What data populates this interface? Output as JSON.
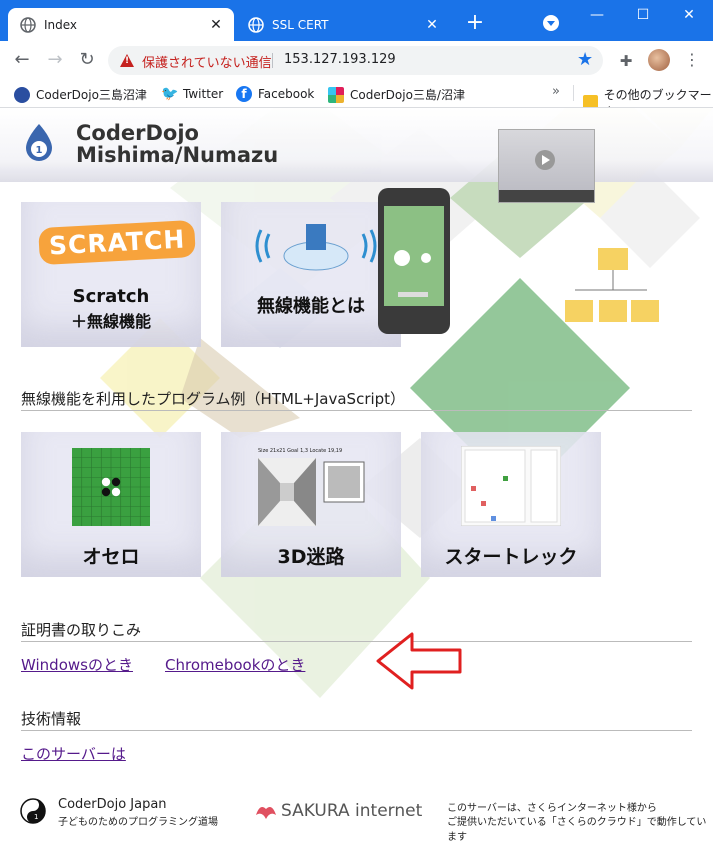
{
  "browser": {
    "tabs": [
      {
        "title": "Index",
        "active": true
      },
      {
        "title": "SSL CERT",
        "active": false
      }
    ],
    "address_bar": {
      "security_warning": "保護されていない通信",
      "url": "153.127.193.129"
    },
    "bookmarks": [
      {
        "label": "CoderDojo三島沼津",
        "icon": "coderdojo-icon"
      },
      {
        "label": "Twitter",
        "icon": "twitter-icon"
      },
      {
        "label": "Facebook",
        "icon": "facebook-icon"
      },
      {
        "label": "CoderDojo三島/沼津",
        "icon": "slack-icon"
      }
    ],
    "other_bookmarks": "その他のブックマーク"
  },
  "site": {
    "brand_line1": "CoderDojo",
    "brand_line2": "Mishima/Numazu"
  },
  "cards_top": [
    {
      "label_line1": "Scratch",
      "label_line2": "＋無線機能",
      "logo_text": "SCRATCH"
    },
    {
      "label_line1": "無線機能とは",
      "label_line2": ""
    }
  ],
  "examples_section": {
    "title": "無線機能を利用したプログラム例（HTML+JavaScript）",
    "cards": [
      {
        "label": "オセロ"
      },
      {
        "label": "3D迷路",
        "thumb_caption": "Size 21x21 Goal 1,3  Locate 19,19"
      },
      {
        "label": "スタートレック"
      }
    ]
  },
  "certificate_section": {
    "title": "証明書の取りこみ",
    "links": [
      "Windowsのとき",
      "Chromebookのとき"
    ]
  },
  "tech_section": {
    "title": "技術情報",
    "links": [
      "このサーバーは"
    ]
  },
  "footer": {
    "org_name": "CoderDojo Japan",
    "org_tagline": "子どものためのプログラミング道場",
    "sponsor": "SAKURA internet",
    "note_line1": "このサーバーは、さくらインターネット様から",
    "note_line2": "ご提供いただいている「さくらのクラウド」で動作しています"
  },
  "colors": {
    "chrome_blue": "#1a73e8",
    "warning_red": "#c5221f",
    "link_visited": "#551a8b",
    "arrow_red": "#e02020",
    "board_green": "#3aa040"
  }
}
